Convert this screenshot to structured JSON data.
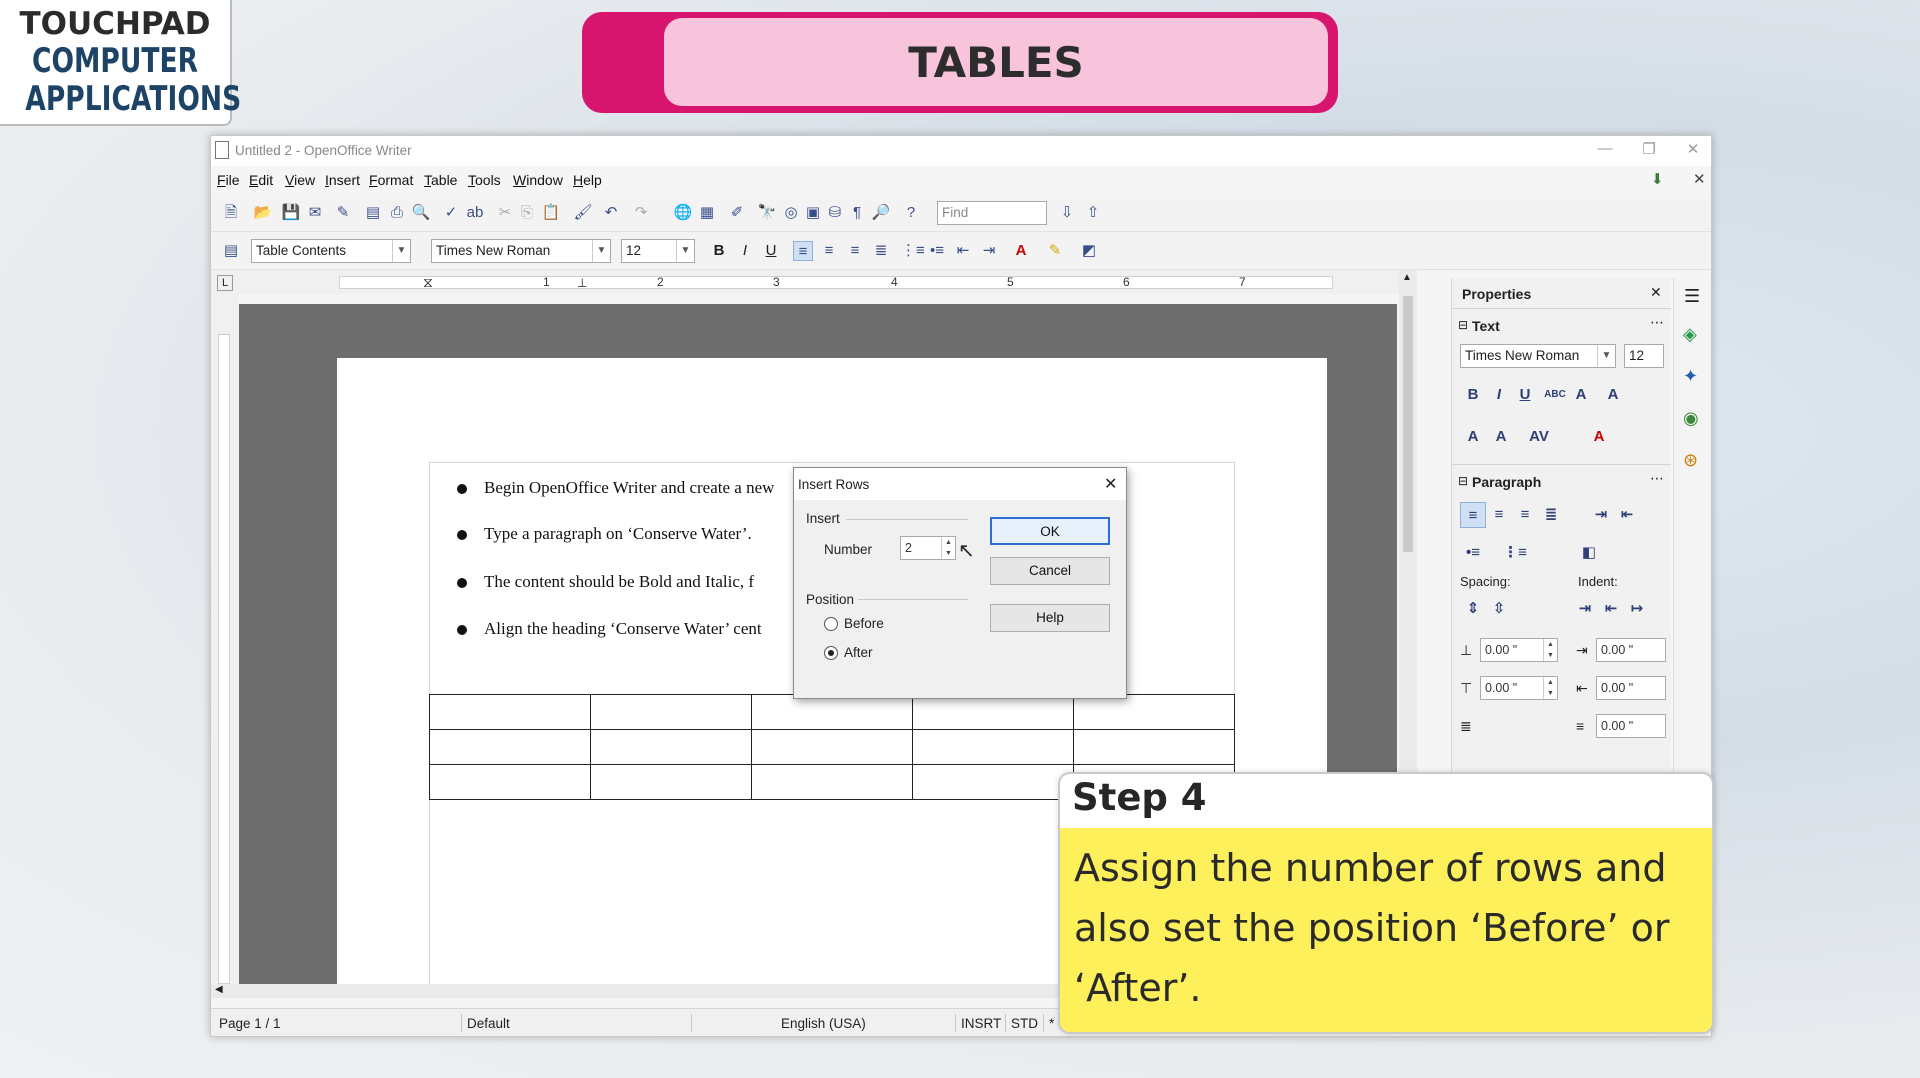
{
  "logo": {
    "brand": "TOUCHPAD",
    "line1": "COMPUTER",
    "line2": "APPLICATIONS"
  },
  "banner": {
    "title": "TABLES"
  },
  "window": {
    "title": "Untitled 2 - OpenOffice Writer",
    "menu": [
      "File",
      "Edit",
      "View",
      "Insert",
      "Format",
      "Table",
      "Tools",
      "Window",
      "Help"
    ],
    "find_placeholder": "Find",
    "style_combo": "Table Contents",
    "font_combo": "Times New Roman",
    "size_combo": "12"
  },
  "ruler": {
    "numbers": [
      "1",
      "2",
      "3",
      "4",
      "5",
      "6",
      "7"
    ]
  },
  "document": {
    "bullets": [
      "Begin OpenOffice Writer and create a new",
      "Type a paragraph on ‘Conserve Water’.",
      "The content should be Bold and Italic, f",
      "Align the heading ‘Conserve Water’ cent"
    ],
    "table": {
      "rows": 3,
      "cols": 5
    }
  },
  "sidebar": {
    "title": "Properties",
    "text_section": "Text",
    "font": "Times New Roman",
    "size": "12",
    "paragraph_section": "Paragraph",
    "spacing_label": "Spacing:",
    "indent_label": "Indent:",
    "spacing_above": "0.00 \"",
    "spacing_below": "0.00 \"",
    "indent_before": "0.00 \"",
    "indent_after": "0.00 \"",
    "indent_first": "0.00 \""
  },
  "dialog": {
    "title": "Insert Rows",
    "insert_group": "Insert",
    "number_label": "Number",
    "number_value": "2",
    "position_group": "Position",
    "before_label": "Before",
    "after_label": "After",
    "selected_position": "After",
    "ok": "OK",
    "cancel": "Cancel",
    "help": "Help"
  },
  "statusbar": {
    "page": "Page 1 / 1",
    "style": "Default",
    "language": "English (USA)",
    "insert_mode": "INSRT",
    "selection_mode": "STD",
    "modified": "*"
  },
  "step": {
    "heading": "Step 4",
    "text": "Assign the number of rows and also set the position ‘Before’ or ‘After’."
  },
  "colors": {
    "banner_outer": "#d8156e",
    "banner_inner": "#f7c4dc",
    "step_body": "#fdf05b",
    "logo_blue": "#1d4466"
  }
}
